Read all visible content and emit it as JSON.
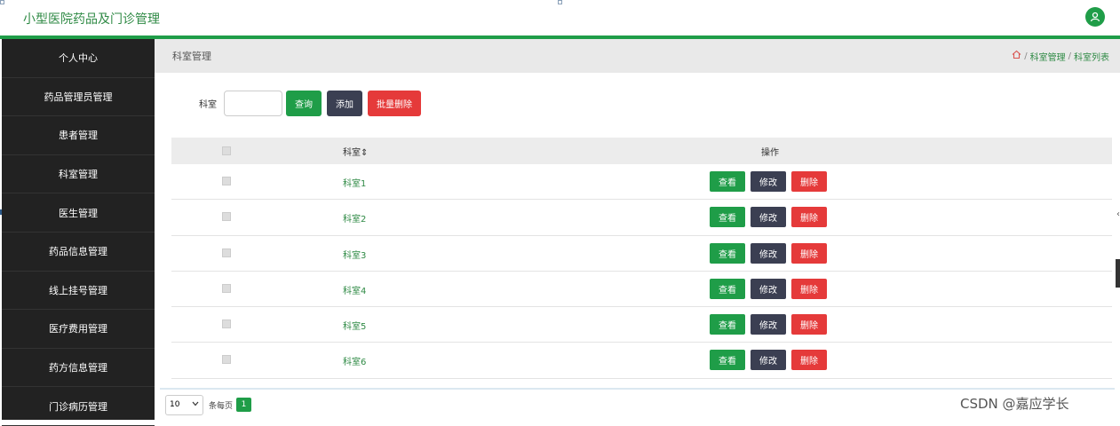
{
  "header": {
    "app_title": "小型医院药品及门诊管理"
  },
  "sidebar": {
    "items": [
      {
        "label": "个人中心"
      },
      {
        "label": "药品管理员管理"
      },
      {
        "label": "患者管理"
      },
      {
        "label": "科室管理"
      },
      {
        "label": "医生管理"
      },
      {
        "label": "药品信息管理"
      },
      {
        "label": "线上挂号管理"
      },
      {
        "label": "医疗费用管理"
      },
      {
        "label": "药方信息管理"
      },
      {
        "label": "门诊病历管理"
      }
    ]
  },
  "breadcrumb": {
    "page_title": "科室管理",
    "path": [
      "科室管理",
      "科室列表"
    ],
    "separator": "/"
  },
  "search": {
    "label": "科室",
    "query_button": "查询",
    "add_button": "添加",
    "batch_delete_button": "批量删除"
  },
  "table": {
    "headers": {
      "name": "科室",
      "ops": "操作"
    },
    "rows": [
      {
        "name": "科室1"
      },
      {
        "name": "科室2"
      },
      {
        "name": "科室3"
      },
      {
        "name": "科室4"
      },
      {
        "name": "科室5"
      },
      {
        "name": "科室6"
      }
    ],
    "row_actions": {
      "view": "查看",
      "edit": "修改",
      "delete": "删除"
    }
  },
  "pager": {
    "page_size": "10",
    "per_page_label": "条每页",
    "current_page": "1"
  },
  "watermark": "CSDN @嘉应学长",
  "colors": {
    "accent": "#1f9d48",
    "danger": "#e53a3a",
    "navy": "#3b3f52",
    "sidebar": "#222222"
  },
  "icons": {
    "user": "user-icon",
    "home": "home-icon",
    "sort": "sort-icon",
    "caret": "chevron-down-icon"
  }
}
